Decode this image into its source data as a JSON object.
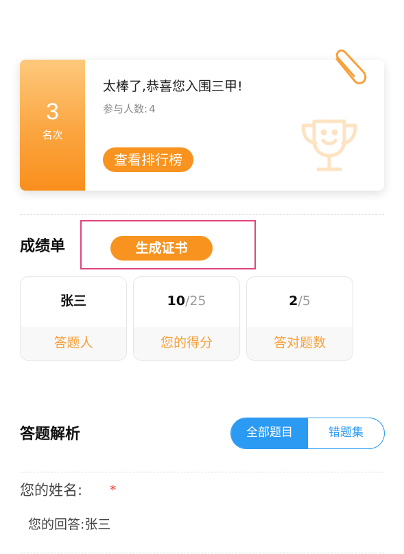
{
  "rank_card": {
    "rank_number": "3",
    "rank_unit": "名次",
    "message": "太棒了,恭喜您入围三甲!",
    "participants_label": "参与人数:",
    "participants_value": "4",
    "leaderboard_button": "查看排行榜",
    "icons": {
      "trophy": "trophy-icon",
      "clip": "paperclip-icon"
    },
    "colors": {
      "accent": "#f7931e",
      "gradient_top": "#fdc97c",
      "gradient_bottom": "#f98f1c"
    }
  },
  "score_sheet": {
    "title": "成绩单",
    "certificate_button": "生成证书",
    "stats": [
      {
        "value": "张三",
        "label": "答题人"
      },
      {
        "value": "10",
        "total": "/25",
        "label": "您的得分"
      },
      {
        "value": "2",
        "total": "/5",
        "label": "答对题数"
      }
    ]
  },
  "analysis": {
    "title": "答题解析",
    "tabs": {
      "all": "全部题目",
      "wrong": "错题集"
    },
    "active_tab": "all",
    "colors": {
      "tab_active": "#2b9af3"
    }
  },
  "questions": [
    {
      "label": "您的姓名:",
      "required_mark": "*",
      "answer_label": "您的回答:",
      "answer": "张三"
    }
  ]
}
